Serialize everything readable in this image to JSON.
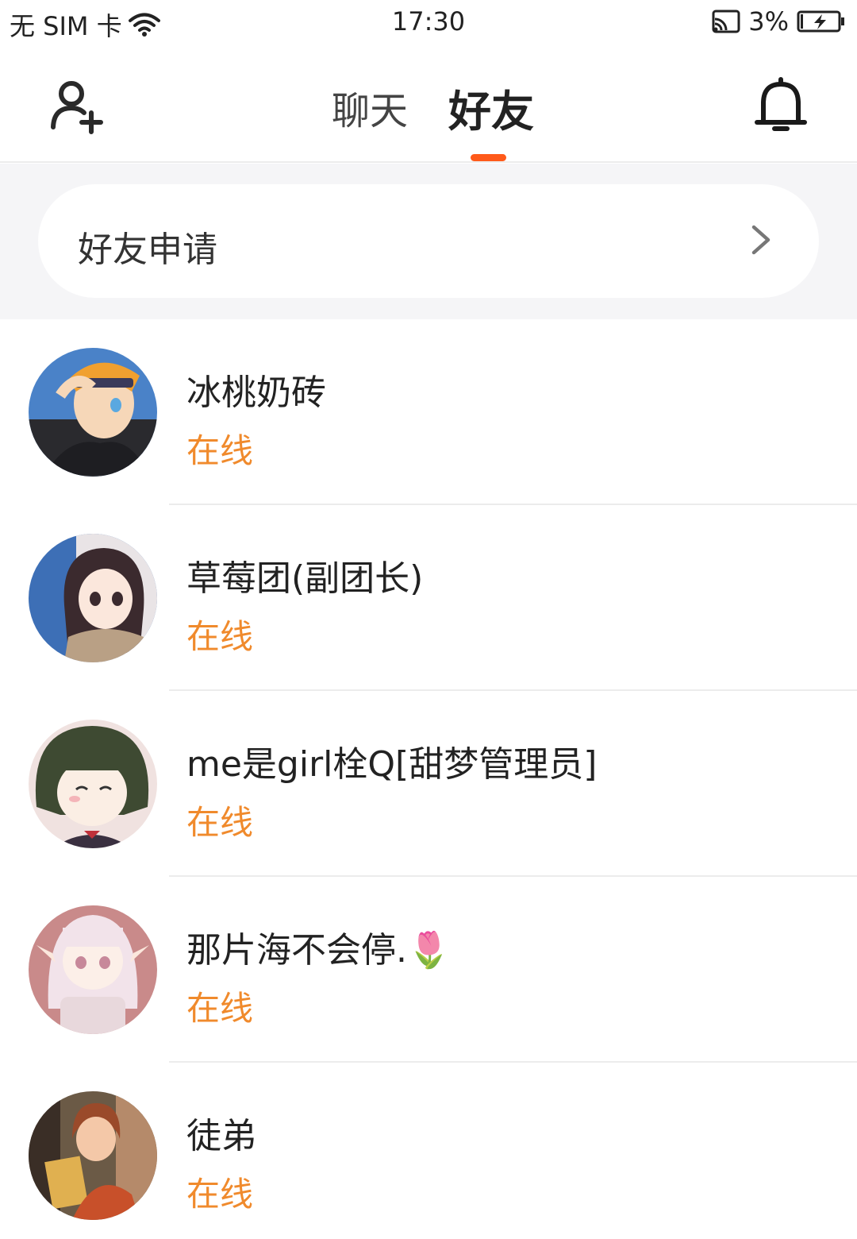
{
  "status_bar": {
    "carrier": "无 SIM 卡",
    "time": "17:30",
    "battery": "3%",
    "icons": [
      "wifi-icon",
      "cast-icon",
      "battery-charging-icon"
    ]
  },
  "header": {
    "tabs": [
      {
        "label": "聊天",
        "active": false
      },
      {
        "label": "好友",
        "active": true
      }
    ],
    "left_icon": "add-user-icon",
    "right_icon": "bell-icon",
    "accent_color": "#ff5a1a"
  },
  "friend_request": {
    "label": "好友申请",
    "icon": "chevron-right-icon"
  },
  "friends": [
    {
      "name": "冰桃奶砖",
      "status": "在线"
    },
    {
      "name": "草莓团(副团长)",
      "status": "在线"
    },
    {
      "name": "me是girl栓Q[甜梦管理员]",
      "status": "在线"
    },
    {
      "name": "那片海不会停.🌷",
      "status": "在线"
    },
    {
      "name": "徒弟",
      "status": "在线"
    }
  ],
  "colors": {
    "status_online": "#f08a2c",
    "background_section": "#f5f5f7"
  }
}
